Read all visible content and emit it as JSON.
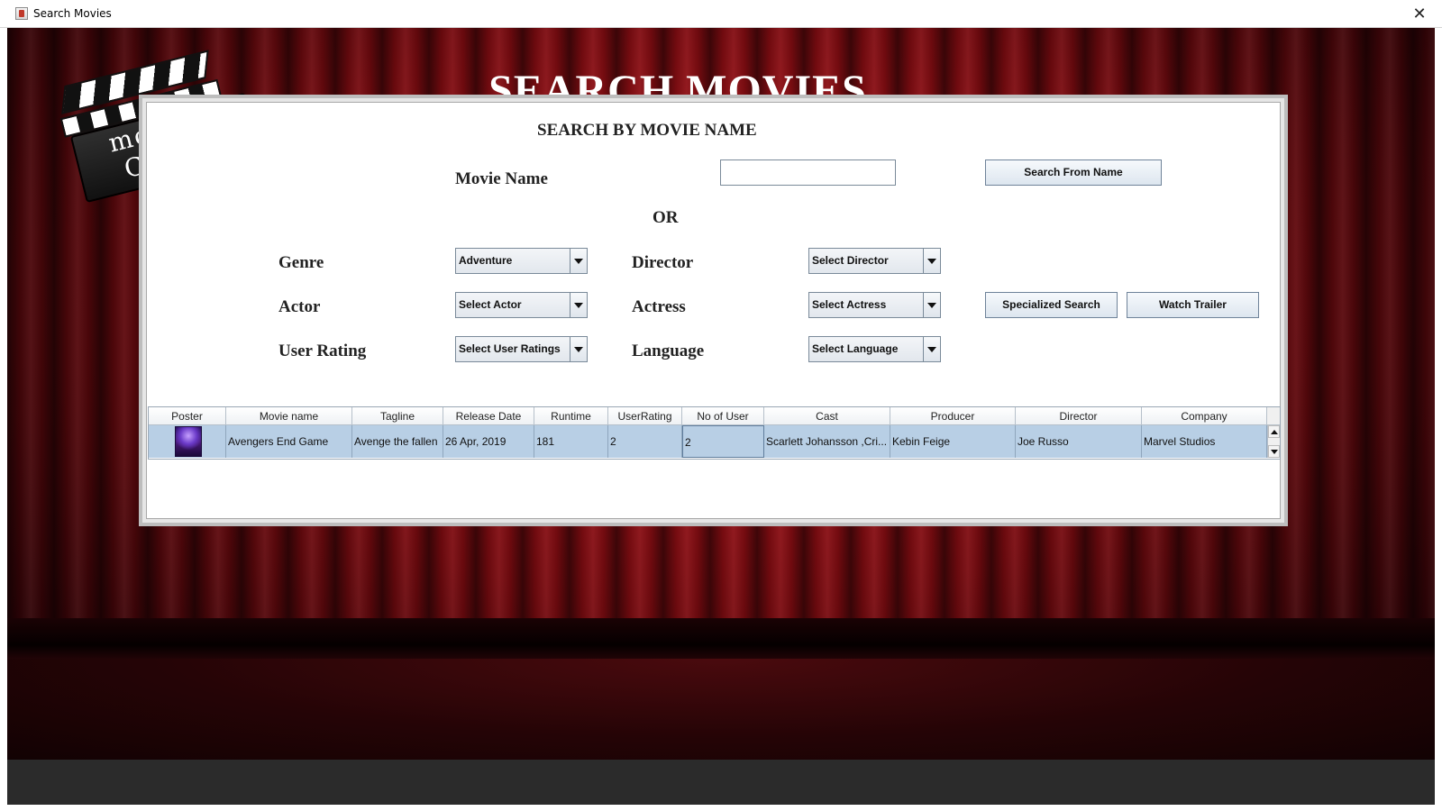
{
  "window": {
    "title": "Search Movies",
    "close_glyph": "✕"
  },
  "logo": {
    "line1": "movie",
    "line2": "CLUB"
  },
  "page": {
    "title": "SEARCH MOVIES"
  },
  "search_by_name": {
    "section_title": "SEARCH BY MOVIE NAME",
    "movie_name_label": "Movie Name",
    "movie_name_value": "",
    "search_button": "Search From Name"
  },
  "or_label": "OR",
  "filters": {
    "genre_label": "Genre",
    "genre_value": "Adventure",
    "director_label": "Director",
    "director_value": "Select Director",
    "actor_label": "Actor",
    "actor_value": "Select Actor",
    "actress_label": "Actress",
    "actress_value": "Select Actress",
    "user_rating_label": "User Rating",
    "user_rating_value": "Select User Ratings",
    "language_label": "Language",
    "language_value": "Select Language",
    "specialized_search_button": "Specialized Search",
    "watch_trailer_button": "Watch Trailer"
  },
  "table": {
    "columns": [
      "Poster",
      "Movie name",
      "Tagline",
      "Release Date",
      "Runtime",
      "UserRating",
      "No of User",
      "Cast",
      "Producer",
      "Director",
      "Company"
    ],
    "rows": [
      {
        "movie_name": "Avengers End Game",
        "tagline": "Avenge the fallen",
        "release_date": "26 Apr, 2019",
        "runtime": "181",
        "user_rating": "2",
        "no_of_user": "2",
        "cast": "Scarlett Johansson ,Cri...",
        "producer": "Kebin Feige",
        "director": "Joe Russo",
        "company": "Marvel Studios"
      }
    ]
  },
  "colors": {
    "curtain": "#8b0d13",
    "selection": "#b8cfe5",
    "panel_border": "#bdbdbd"
  },
  "icons": {
    "window_icon": "java-app-icon",
    "close": "close-icon",
    "dropdown": "chevron-down-icon",
    "scroll_up": "arrow-up-icon",
    "scroll_down": "arrow-down-icon"
  }
}
